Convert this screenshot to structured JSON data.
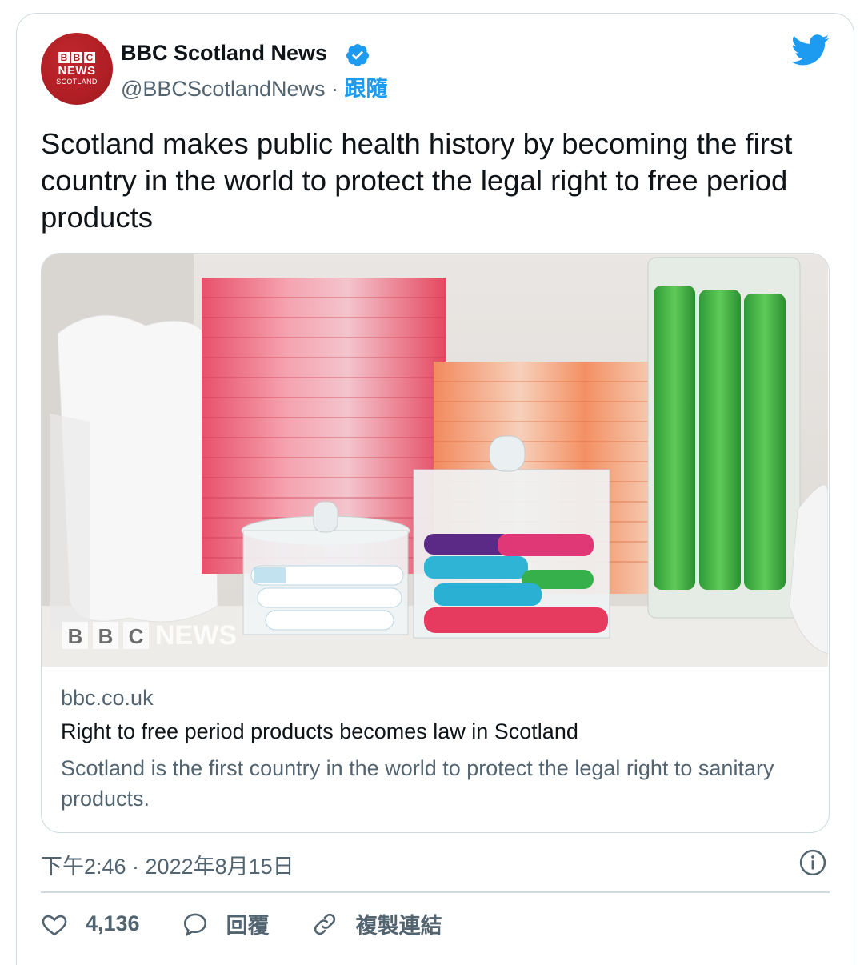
{
  "author": {
    "name": "BBC Scotland News",
    "handle": "@BBCScotlandNews",
    "separator": "·",
    "follow_label": "跟隨",
    "avatar": {
      "bbc_letters": [
        "B",
        "B",
        "C"
      ],
      "news": "NEWS",
      "region": "SCOTLAND"
    }
  },
  "tweet": {
    "text": "Scotland makes public health history by becoming the first country in the world to protect the legal right to free period products"
  },
  "link_card": {
    "image_watermark_letters": [
      "B",
      "B",
      "C"
    ],
    "image_watermark_news": "NEWS",
    "domain": "bbc.co.uk",
    "title": "Right to free period products becomes law in Scotland",
    "description": "Scotland is the first country in the world to protect the legal right to sanitary products."
  },
  "meta": {
    "timestamp": "下午2:46 · 2022年8月15日"
  },
  "actions": {
    "likes": "4,136",
    "reply_label": "回覆",
    "copy_link_label": "複製連結"
  },
  "colors": {
    "accent": "#1d9bf0",
    "text_primary": "#0f1419",
    "text_secondary": "#536471",
    "border": "#cfd9de",
    "bbc_red": "#b01f25"
  },
  "icons": [
    "twitter-bird-icon",
    "verified-badge-icon",
    "info-icon",
    "heart-icon",
    "reply-bubble-icon",
    "link-icon"
  ]
}
